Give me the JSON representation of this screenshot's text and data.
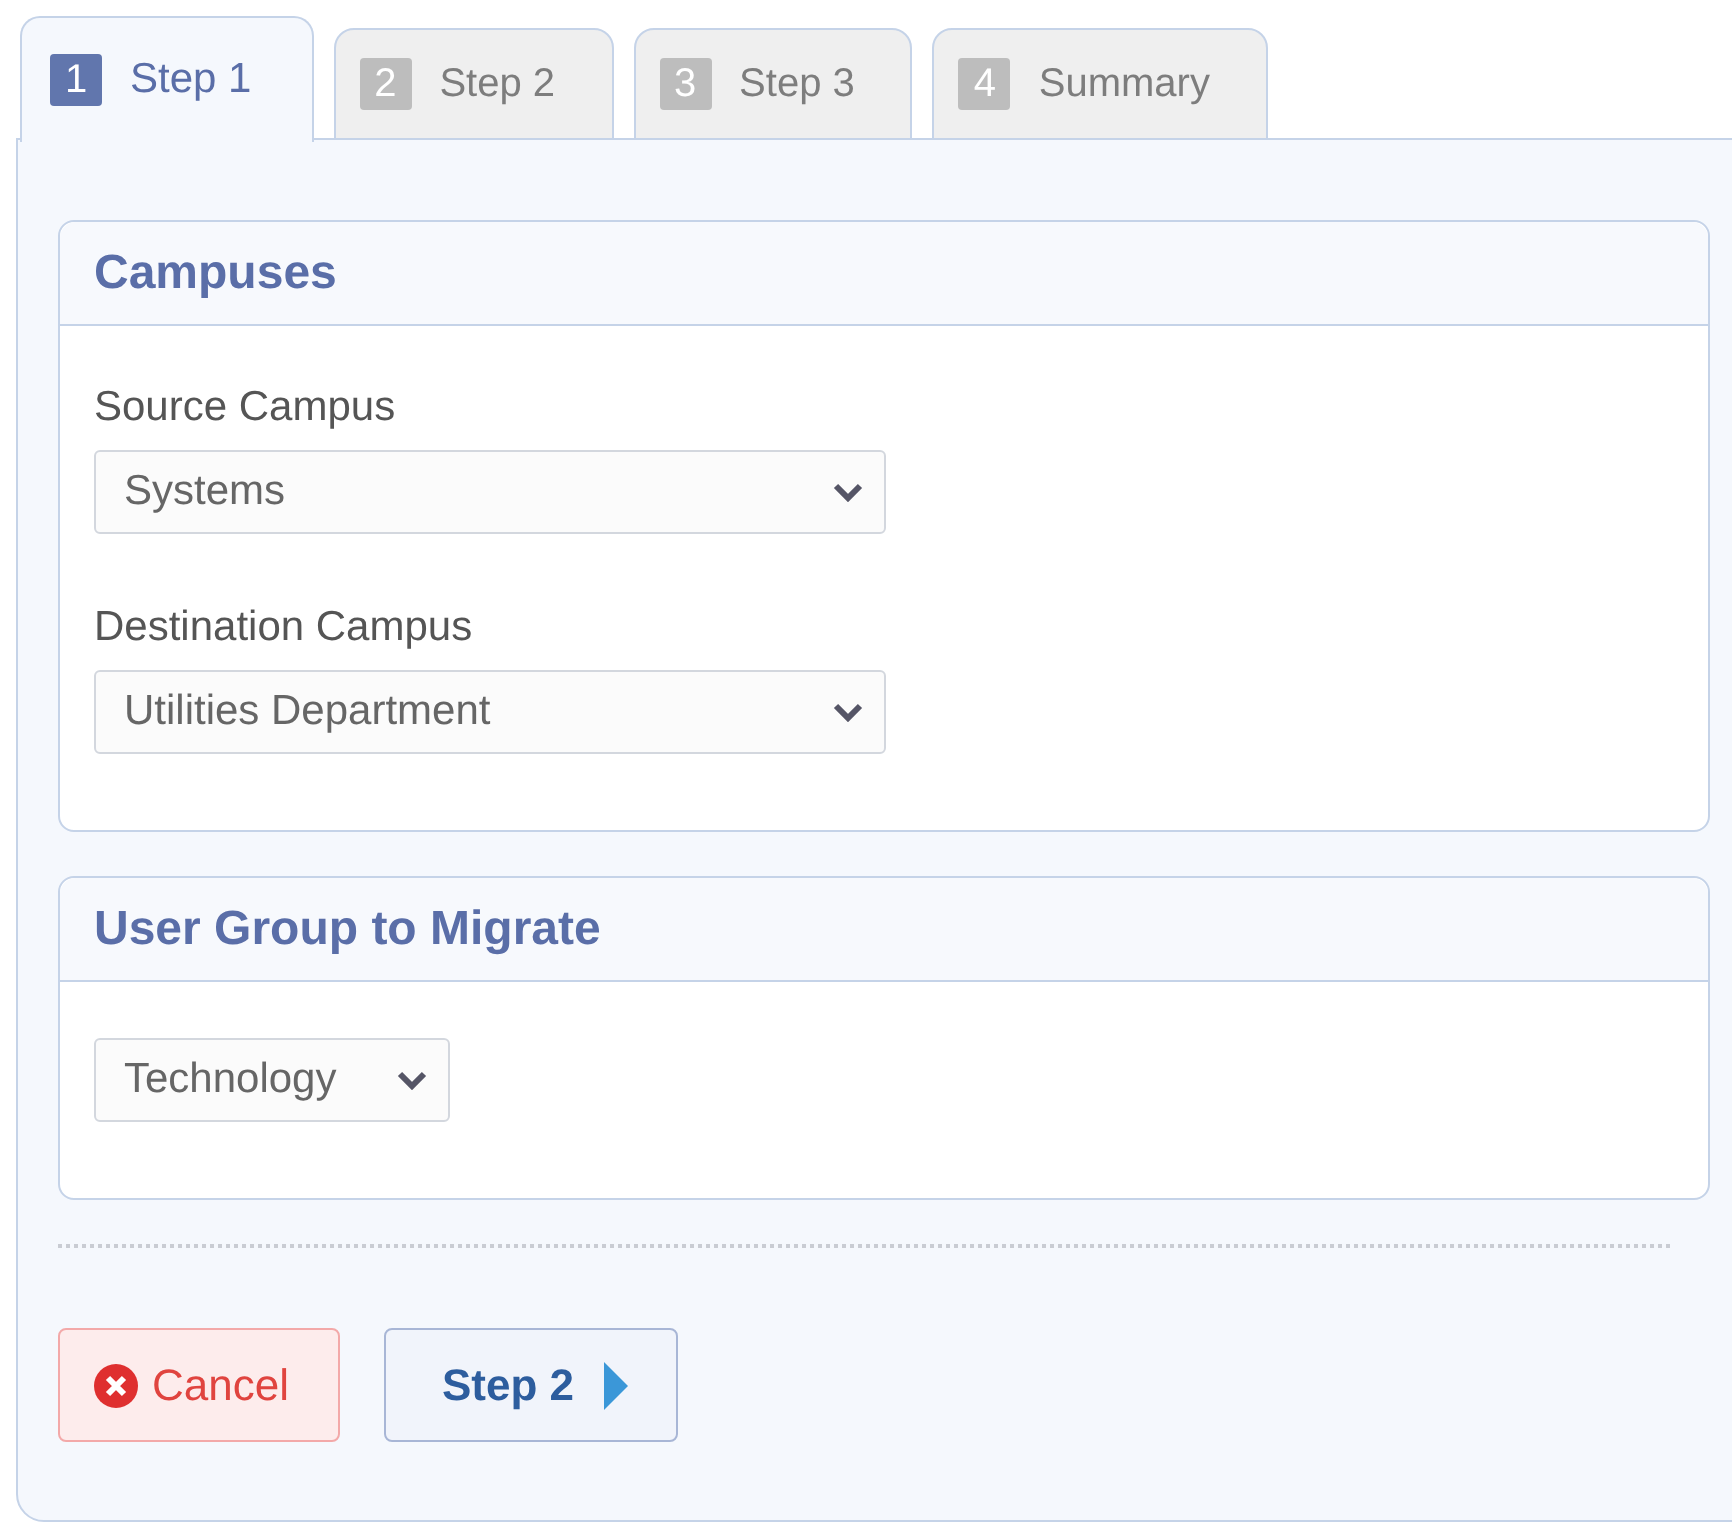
{
  "tabs": [
    {
      "number": "1",
      "label": "Step 1",
      "selected": true
    },
    {
      "number": "2",
      "label": "Step 2",
      "selected": false
    },
    {
      "number": "3",
      "label": "Step 3",
      "selected": false
    },
    {
      "number": "4",
      "label": "Summary",
      "selected": false
    }
  ],
  "sections": [
    {
      "title": "Campuses",
      "fields": [
        {
          "label": "Source Campus",
          "value": "Systems",
          "wide": true
        },
        {
          "label": "Destination Campus",
          "value": "Utilities Department",
          "wide": true
        }
      ]
    },
    {
      "title": "User Group to Migrate",
      "fields": [
        {
          "value": "Technology",
          "wide": false
        }
      ]
    }
  ],
  "buttons": [
    {
      "kind": "cancel",
      "label": "Cancel"
    },
    {
      "kind": "next",
      "label": "Step 2"
    }
  ]
}
